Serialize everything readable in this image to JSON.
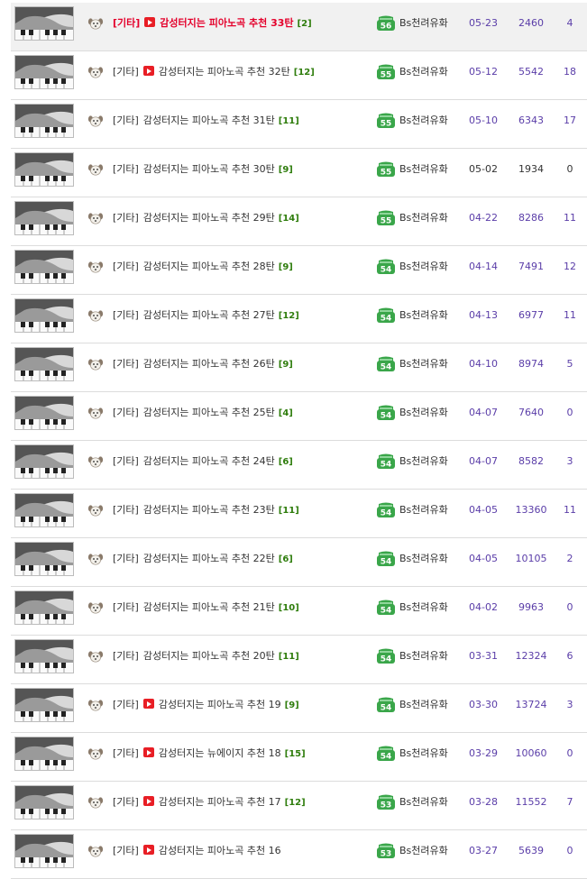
{
  "rows": [
    {
      "category": "[기타]",
      "has_video": true,
      "title": "감성터지는 피아노곡 추천 33탄",
      "comments": "[2]",
      "level": "56",
      "author": "Bs천려유화",
      "date": "05-23",
      "views": "2460",
      "likes": "4",
      "highlight": true
    },
    {
      "category": "[기타]",
      "has_video": true,
      "title": "감성터지는 피아노곡 추천 32탄",
      "comments": "[12]",
      "level": "55",
      "author": "Bs천려유화",
      "date": "05-12",
      "views": "5542",
      "likes": "18"
    },
    {
      "category": "[기타]",
      "has_video": false,
      "title": "감성터지는 피아노곡 추천 31탄",
      "comments": "[11]",
      "level": "55",
      "author": "Bs천려유화",
      "date": "05-10",
      "views": "6343",
      "likes": "17"
    },
    {
      "category": "[기타]",
      "has_video": false,
      "title": "감성터지는 피아노곡 추천 30탄",
      "comments": "[9]",
      "level": "55",
      "author": "Bs천려유화",
      "date": "05-02",
      "views": "1934",
      "likes": "0",
      "plain": true
    },
    {
      "category": "[기타]",
      "has_video": false,
      "title": "감성터지는 피아노곡 추천 29탄",
      "comments": "[14]",
      "level": "55",
      "author": "Bs천려유화",
      "date": "04-22",
      "views": "8286",
      "likes": "11"
    },
    {
      "category": "[기타]",
      "has_video": false,
      "title": "감성터지는 피아노곡 추천 28탄",
      "comments": "[9]",
      "level": "54",
      "author": "Bs천려유화",
      "date": "04-14",
      "views": "7491",
      "likes": "12"
    },
    {
      "category": "[기타]",
      "has_video": false,
      "title": "감성터지는 피아노곡 추천 27탄",
      "comments": "[12]",
      "level": "54",
      "author": "Bs천려유화",
      "date": "04-13",
      "views": "6977",
      "likes": "11"
    },
    {
      "category": "[기타]",
      "has_video": false,
      "title": "감성터지는 피아노곡 추천 26탄",
      "comments": "[9]",
      "level": "54",
      "author": "Bs천려유화",
      "date": "04-10",
      "views": "8974",
      "likes": "5"
    },
    {
      "category": "[기타]",
      "has_video": false,
      "title": "감성터지는 피아노곡 추천 25탄",
      "comments": "[4]",
      "level": "54",
      "author": "Bs천려유화",
      "date": "04-07",
      "views": "7640",
      "likes": "0"
    },
    {
      "category": "[기타]",
      "has_video": false,
      "title": "감성터지는 피아노곡 추천 24탄",
      "comments": "[6]",
      "level": "54",
      "author": "Bs천려유화",
      "date": "04-07",
      "views": "8582",
      "likes": "3"
    },
    {
      "category": "[기타]",
      "has_video": false,
      "title": "감성터지는 피아노곡 추천 23탄",
      "comments": "[11]",
      "level": "54",
      "author": "Bs천려유화",
      "date": "04-05",
      "views": "13360",
      "likes": "11"
    },
    {
      "category": "[기타]",
      "has_video": false,
      "title": "감성터지는 피아노곡 추천 22탄",
      "comments": "[6]",
      "level": "54",
      "author": "Bs천려유화",
      "date": "04-05",
      "views": "10105",
      "likes": "2"
    },
    {
      "category": "[기타]",
      "has_video": false,
      "title": "감성터지는 피아노곡 추천 21탄",
      "comments": "[10]",
      "level": "54",
      "author": "Bs천려유화",
      "date": "04-02",
      "views": "9963",
      "likes": "0"
    },
    {
      "category": "[기타]",
      "has_video": false,
      "title": "감성터지는 피아노곡 추천 20탄",
      "comments": "[11]",
      "level": "54",
      "author": "Bs천려유화",
      "date": "03-31",
      "views": "12324",
      "likes": "6"
    },
    {
      "category": "[기타]",
      "has_video": true,
      "title": "감성터지는 피아노곡 추천 19",
      "comments": "[9]",
      "level": "54",
      "author": "Bs천려유화",
      "date": "03-30",
      "views": "13724",
      "likes": "3"
    },
    {
      "category": "[기타]",
      "has_video": true,
      "title": "감성터지는 뉴에이지 추천 18",
      "comments": "[15]",
      "level": "54",
      "author": "Bs천려유화",
      "date": "03-29",
      "views": "10060",
      "likes": "0"
    },
    {
      "category": "[기타]",
      "has_video": true,
      "title": "감성터지는 피아노곡 추천 17",
      "comments": "[12]",
      "level": "53",
      "author": "Bs천려유화",
      "date": "03-28",
      "views": "11552",
      "likes": "7"
    },
    {
      "category": "[기타]",
      "has_video": true,
      "title": "감성터지는 피아노곡 추천 16",
      "comments": "",
      "level": "53",
      "author": "Bs천려유화",
      "date": "03-27",
      "views": "5639",
      "likes": "0"
    }
  ],
  "icons": {
    "thumbnail": "piano-hands-thumbnail",
    "user": "puppy-face-icon",
    "level": "level-badge-icon",
    "video": "video-play-icon"
  },
  "colors": {
    "highlight_title": "#e4002b",
    "comment_count": "#2f7d0d",
    "stat_text": "#5a3da8",
    "level_badge": "#3aa64a",
    "highlight_row_bg": "#f1f1f1"
  }
}
